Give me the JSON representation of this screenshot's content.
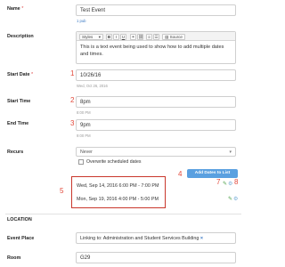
{
  "form": {
    "name": {
      "label": "Name",
      "required_mark": "*",
      "value": "Test Event",
      "sublink": "1 pub"
    },
    "description": {
      "label": "Description",
      "toolbar": {
        "styles": "Styles",
        "bold": "B",
        "italic": "I",
        "underline": "U",
        "source": "Source"
      },
      "text": "This is a text event being used to show how to add multiple dates and times."
    },
    "start_date": {
      "label": "Start Date",
      "required_mark": "*",
      "value": "10/26/16",
      "hint": "Wed, Oct 26, 2016",
      "marker": "1"
    },
    "start_time": {
      "label": "Start Time",
      "value": "8pm",
      "hint": "8:00 PM",
      "marker": "2"
    },
    "end_time": {
      "label": "End Time",
      "value": "9pm",
      "hint": "9:00 PM",
      "marker": "3"
    },
    "recurs": {
      "label": "Recurs",
      "value": "Never",
      "checkbox_label": "Overwrite scheduled dates"
    },
    "add_dates": {
      "label": "Add Dates to List",
      "marker": "4"
    },
    "dates_list": {
      "marker": "5",
      "rows": [
        "Wed, Sep 14, 2016 6:00 PM - 7:00 PM",
        "Mon, Sep 19, 2016 4:00 PM - 5:00 PM"
      ],
      "action_markers": {
        "edit": "7",
        "duplicate": "8"
      }
    },
    "location_heading": "LOCATION",
    "event_place": {
      "label": "Event Place",
      "value": "Linking to: Administration and Student Services Building",
      "remove": "×"
    },
    "room": {
      "label": "Room",
      "value": "G29"
    }
  },
  "icons": {
    "edit": "pencil-icon",
    "duplicate": "gear-icon",
    "dropdown": "chevron-down-icon"
  },
  "colors": {
    "accent": "#5aa0e0",
    "marker": "#e2483a",
    "box_border": "#c9372c",
    "edit_icon": "#52a34d"
  }
}
